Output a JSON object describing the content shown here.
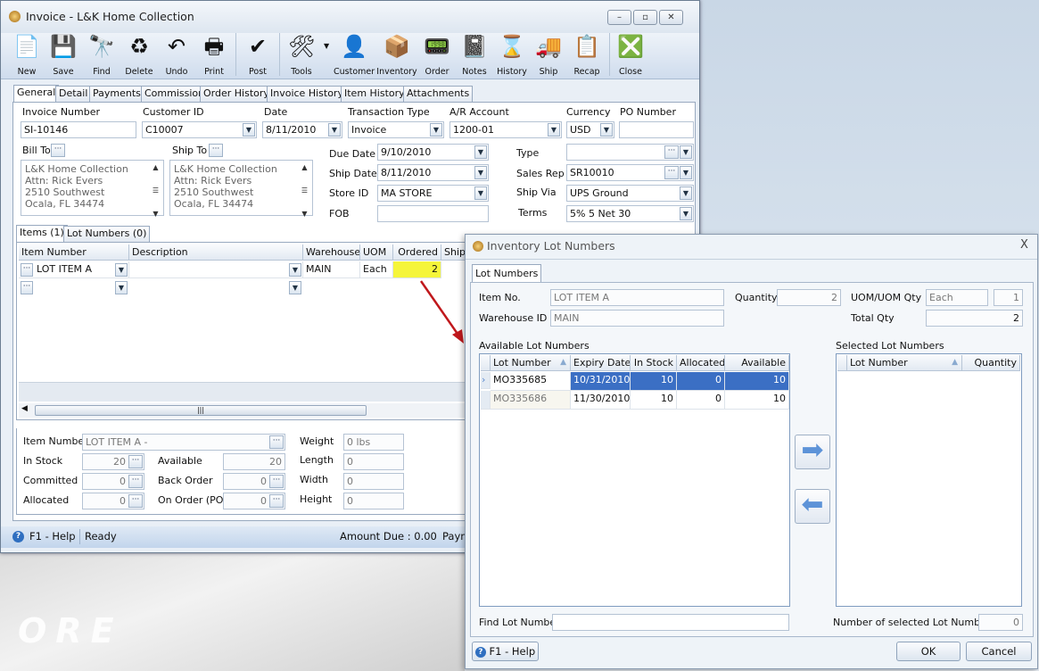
{
  "window": {
    "title": "Invoice - L&K Home Collection",
    "minimize": "–",
    "restore": "▫",
    "close": "✕"
  },
  "toolbar": [
    {
      "label": "New",
      "icon": "new-document-icon",
      "glyph": "📄"
    },
    {
      "label": "Save",
      "icon": "floppy-disk-icon",
      "glyph": "💾"
    },
    {
      "label": "Find",
      "icon": "binoculars-icon",
      "glyph": "🔭"
    },
    {
      "label": "Delete",
      "icon": "recycle-bin-icon",
      "glyph": "♻"
    },
    {
      "label": "Undo",
      "icon": "undo-arrow-icon",
      "glyph": "↶"
    },
    {
      "label": "Print",
      "icon": "printer-icon",
      "glyph": "🖶"
    },
    {
      "label": "Post",
      "icon": "post-checkmark-icon",
      "glyph": "✔"
    },
    {
      "label": "Tools",
      "icon": "tools-icon",
      "glyph": "🛠"
    },
    {
      "label": "Customer",
      "icon": "customer-person-icon",
      "glyph": "👤"
    },
    {
      "label": "Inventory",
      "icon": "inventory-boxes-icon",
      "glyph": "📦"
    },
    {
      "label": "Order",
      "icon": "order-device-icon",
      "glyph": "📟"
    },
    {
      "label": "Notes",
      "icon": "notes-notebook-icon",
      "glyph": "📓"
    },
    {
      "label": "History",
      "icon": "history-hourglass-icon",
      "glyph": "⌛"
    },
    {
      "label": "Ship",
      "icon": "ship-forklift-icon",
      "glyph": "🚚"
    },
    {
      "label": "Recap",
      "icon": "recap-sheet-icon",
      "glyph": "📋"
    },
    {
      "label": "Close",
      "icon": "close-window-icon",
      "glyph": "❎"
    }
  ],
  "tabs": [
    "General",
    "Detail",
    "Payments",
    "Commission",
    "Order History",
    "Invoice History",
    "Item History",
    "Attachments"
  ],
  "header": {
    "invoice_number": {
      "label": "Invoice Number",
      "value": "SI-10146"
    },
    "customer_id": {
      "label": "Customer ID",
      "value": "C10007"
    },
    "date": {
      "label": "Date",
      "value": "8/11/2010"
    },
    "transaction_type": {
      "label": "Transaction Type",
      "value": "Invoice"
    },
    "ar_account": {
      "label": "A/R Account",
      "value": "1200-01"
    },
    "currency": {
      "label": "Currency",
      "value": "USD"
    },
    "po_number": {
      "label": "PO Number",
      "value": ""
    },
    "bill_to": {
      "label": "Bill To",
      "lines": [
        "L&K Home Collection",
        "Attn: Rick Evers",
        "2510 Southwest",
        "Ocala, FL 34474"
      ]
    },
    "ship_to": {
      "label": "Ship To",
      "lines": [
        "L&K Home Collection",
        "Attn: Rick Evers",
        "2510 Southwest",
        "Ocala, FL 34474"
      ]
    },
    "due_date": {
      "label": "Due Date",
      "value": "9/10/2010"
    },
    "ship_date": {
      "label": "Ship Date",
      "value": "8/11/2010"
    },
    "store_id": {
      "label": "Store ID",
      "value": "MA STORE"
    },
    "fob": {
      "label": "FOB",
      "value": ""
    },
    "type": {
      "label": "Type",
      "value": ""
    },
    "sales_rep": {
      "label": "Sales Rep",
      "value": "SR10010"
    },
    "ship_via": {
      "label": "Ship Via",
      "value": "UPS Ground"
    },
    "terms": {
      "label": "Terms",
      "value": "5% 5 Net 30"
    }
  },
  "items_tabs": [
    "Items (1)",
    "Lot Numbers (0)"
  ],
  "items_grid": {
    "columns": [
      "Item Number",
      "Description",
      "Warehouse",
      "UOM",
      "Ordered",
      "Ship"
    ],
    "rows": [
      {
        "item": "LOT ITEM A",
        "description": "",
        "warehouse": "MAIN",
        "uom": "Each",
        "ordered": "2"
      }
    ]
  },
  "item_info": {
    "item_number": {
      "label": "Item Number",
      "value": "LOT ITEM A -"
    },
    "in_stock": {
      "label": "In Stock",
      "value": "20"
    },
    "committed": {
      "label": "Committed",
      "value": "0"
    },
    "allocated": {
      "label": "Allocated",
      "value": "0"
    },
    "available": {
      "label": "Available",
      "value": "20"
    },
    "back_order": {
      "label": "Back Order",
      "value": "0"
    },
    "on_order": {
      "label": "On Order (PO)",
      "value": "0"
    },
    "weight": {
      "label": "Weight",
      "value": "0 lbs"
    },
    "length": {
      "label": "Length",
      "value": "0"
    },
    "width": {
      "label": "Width",
      "value": "0"
    },
    "height": {
      "label": "Height",
      "value": "0"
    }
  },
  "status": {
    "help": "F1 - Help",
    "state": "Ready",
    "amount_due": "Amount Due : 0.00",
    "payment": "Paym"
  },
  "dialog": {
    "title": "Inventory Lot Numbers",
    "close": "X",
    "tab": "Lot Numbers",
    "item_no": {
      "label": "Item No.",
      "value": "LOT ITEM A"
    },
    "warehouse_id": {
      "label": "Warehouse ID",
      "value": "MAIN"
    },
    "quantity": {
      "label": "Quantity",
      "value": "2"
    },
    "uom": {
      "label": "UOM/UOM Qty",
      "value": "Each",
      "qty": "1"
    },
    "total_qty": {
      "label": "Total Qty",
      "value": "2"
    },
    "available_label": "Available Lot Numbers",
    "available_columns": [
      "Lot Number",
      "Expiry Date",
      "In Stock",
      "Allocated",
      "Available"
    ],
    "available_rows": [
      {
        "lot": "MO335685",
        "expiry": "10/31/2010",
        "in_stock": "10",
        "allocated": "0",
        "available": "10"
      },
      {
        "lot": "MO335686",
        "expiry": "11/30/2010",
        "in_stock": "10",
        "allocated": "0",
        "available": "10"
      }
    ],
    "selected_label": "Selected Lot Numbers",
    "selected_columns": [
      "Lot Number",
      "Quantity"
    ],
    "add_arrow": "➡",
    "remove_arrow": "⬅",
    "find_label": "Find Lot Number",
    "find_value": "",
    "count_label": "Number of selected Lot Numbers",
    "count_value": "0",
    "help": "F1 - Help",
    "ok": "OK",
    "cancel": "Cancel"
  },
  "colors": {
    "highlight": "#f5f53a",
    "selection": "#3b6fc4",
    "annotation_arrow": "#c0181c"
  }
}
